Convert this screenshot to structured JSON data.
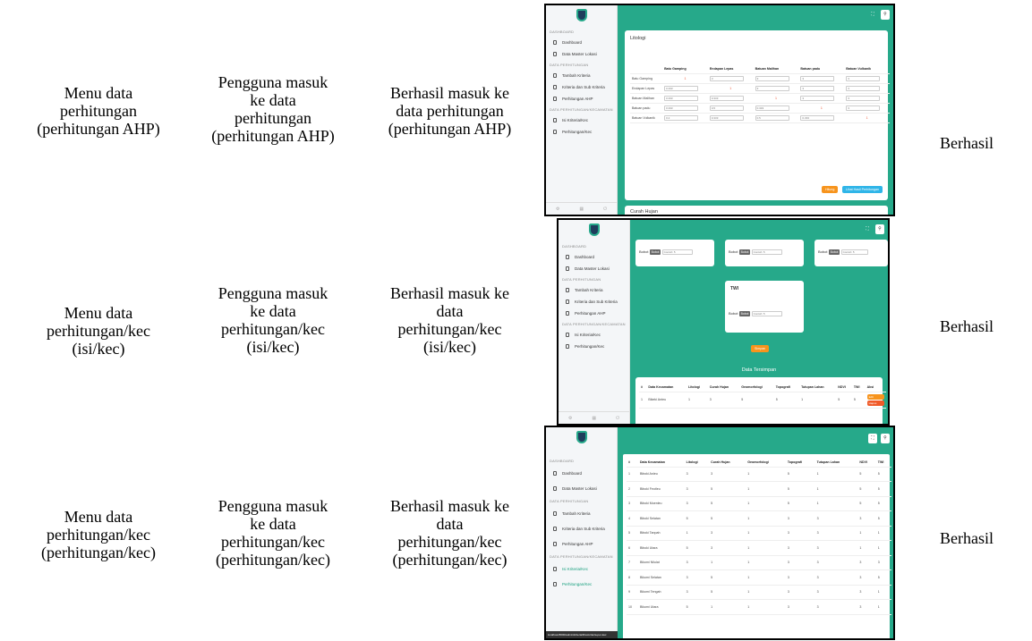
{
  "rows": [
    {
      "menu": [
        "Menu data",
        "perhitungan",
        "(perhitungan AHP)"
      ],
      "action": [
        "Pengguna masuk",
        "ke data",
        "perhitungan",
        "(perhitungan AHP)"
      ],
      "expected": [
        "Berhasil masuk ke",
        "data perhitungan",
        "(perhitungan AHP)"
      ],
      "result": "Berhasil"
    },
    {
      "menu": [
        "Menu data",
        "perhitungan/kec",
        "(isi/kec)"
      ],
      "action": [
        "Pengguna masuk",
        "ke data",
        "perhitungan/kec",
        "(isi/kec)"
      ],
      "expected": [
        "Berhasil masuk ke",
        "data",
        "perhitungan/kec",
        "(isi/kec)"
      ],
      "result": "Berhasil"
    },
    {
      "menu": [
        "Menu data",
        "perhitungan/kec",
        "(perhitungan/kec)"
      ],
      "action": [
        "Pengguna masuk",
        "ke data",
        "perhitungan/kec",
        "(perhitungan/kec)"
      ],
      "expected": [
        "Berhasil masuk ke",
        "data",
        "perhitungan/kec",
        "(perhitungan/kec)"
      ],
      "result": "Berhasil"
    }
  ],
  "sidebar": {
    "head_dashboard": "DASHBOARD",
    "dashboard": "Dashboard",
    "master": "Data Master Lokasi",
    "head_perhitungan": "DATA PERHITUNGAN",
    "tambah": "Tambah Kriteria",
    "kriteria": "Kriteria dan Sub Kriteria",
    "ahp": "Perhitungan AHP",
    "head_kec": "DATA PERHITUNGAN/KECAMATAN",
    "isi": "Isi Kriteria/Kec",
    "perkec": "Perhitungan/Kec"
  },
  "shot1": {
    "title": "Litologi",
    "cols": [
      "Batu Gamping",
      "Endapan Lepas",
      "Batuan Malihan",
      "Batuan padu",
      "Batuan Vulkanik"
    ],
    "rows": [
      {
        "label": "Batu Gamping",
        "cells": [
          "1",
          "3",
          "3",
          "3",
          "3"
        ]
      },
      {
        "label": "Endapan Lepas",
        "cells": [
          "0.333",
          "1",
          "3",
          "3",
          "3"
        ]
      },
      {
        "label": "Batuan Malihan",
        "cells": [
          "0.333",
          "0.333",
          "1",
          "3",
          "3"
        ]
      },
      {
        "label": "Batuan padu",
        "cells": [
          "0.333",
          "0.5",
          "0.333",
          "1",
          "3"
        ]
      },
      {
        "label": "Batuan Vulkanik",
        "cells": [
          "0.2",
          "0.333",
          "0.5",
          "0.333",
          "1"
        ]
      }
    ],
    "btn_hitung": "Hitung",
    "btn_lihat": "Lihat Hasil Perhitungan",
    "next_title": "Curah Hujan"
  },
  "shot2": {
    "bobot": "Bobot",
    "tag": "Bobot",
    "placeholder": "Contoh: 5",
    "twi": "TWI",
    "simpan": "Simpan",
    "tersimpan": "Data Tersimpan",
    "cols": [
      "#",
      "Data Kecamatan",
      "Litologi",
      "Curah Hujan",
      "Geomorfologi",
      "Topografi",
      "Tutupan Lahan",
      "NDVI",
      "TWI",
      "Aksi"
    ],
    "row": [
      "1",
      "Bikeki Anteu",
      "1",
      "3",
      "5",
      "5",
      "1",
      "5",
      "5"
    ],
    "edit": "Edit",
    "hapus": "Hapus"
  },
  "shot3": {
    "cols": [
      "#",
      "Data Kecamatan",
      "Litologi",
      "Curah Hujan",
      "Geomorfologi",
      "Topografi",
      "Tutupan Lahan",
      "NDVI",
      "TWI"
    ],
    "rows": [
      [
        "1",
        "Biboki Anleu",
        "3",
        "3",
        "1",
        "5",
        "1",
        "5",
        "5"
      ],
      [
        "2",
        "Biboki Feotleu",
        "3",
        "5",
        "1",
        "5",
        "1",
        "5",
        "5"
      ],
      [
        "3",
        "Biboki Moenleu",
        "3",
        "5",
        "1",
        "5",
        "1",
        "5",
        "5"
      ],
      [
        "4",
        "Biboki Selatan",
        "5",
        "5",
        "1",
        "3",
        "3",
        "3",
        "5"
      ],
      [
        "5",
        "Biboki Tanpah",
        "1",
        "3",
        "1",
        "3",
        "3",
        "1",
        "1"
      ],
      [
        "6",
        "Biboki Utara",
        "5",
        "3",
        "1",
        "3",
        "3",
        "1",
        "1"
      ],
      [
        "7",
        "Bikomi Nilulat",
        "3",
        "1",
        "1",
        "3",
        "3",
        "3",
        "3"
      ],
      [
        "8",
        "Bikomi Selatan",
        "3",
        "5",
        "1",
        "3",
        "3",
        "3",
        "5"
      ],
      [
        "9",
        "Bikomi Tengah",
        "3",
        "5",
        "1",
        "3",
        "3",
        "3",
        "1"
      ],
      [
        "10",
        "Bikomi Utara",
        "5",
        "1",
        "1",
        "3",
        "3",
        "3",
        "1"
      ]
    ],
    "status_url": "localhost:8000/admin/kriteria/lihat-kriteria-per-kec"
  }
}
